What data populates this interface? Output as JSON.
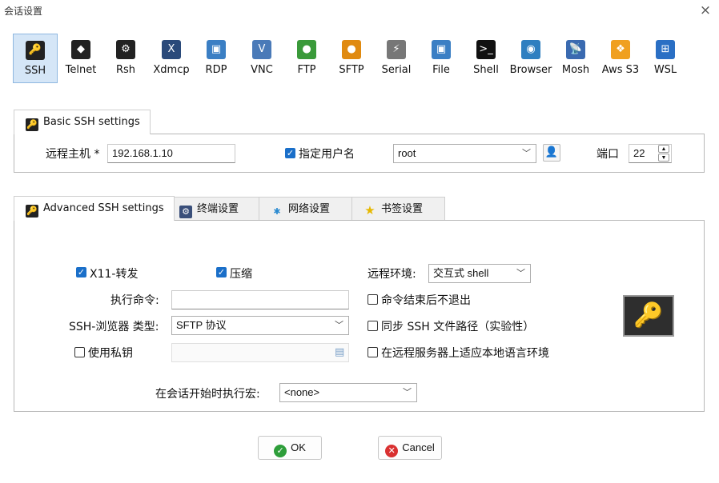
{
  "window": {
    "title": "会话设置",
    "close_glyph": "×"
  },
  "protocols": [
    {
      "label": "SSH",
      "icon": "ssh-key-icon",
      "color": "#222222",
      "glyph": "🔑",
      "active": true
    },
    {
      "label": "Telnet",
      "icon": "telnet-icon",
      "color": "#222222",
      "glyph": "◆"
    },
    {
      "label": "Rsh",
      "icon": "rsh-icon",
      "color": "#222222",
      "glyph": "⚙"
    },
    {
      "label": "Xdmcp",
      "icon": "xdmcp-icon",
      "color": "#2a4a7a",
      "glyph": "X"
    },
    {
      "label": "RDP",
      "icon": "rdp-icon",
      "color": "#3b7fc4",
      "glyph": "▣"
    },
    {
      "label": "VNC",
      "icon": "vnc-icon",
      "color": "#4a7ab8",
      "glyph": "V"
    },
    {
      "label": "FTP",
      "icon": "ftp-globe-icon",
      "color": "#3a9a3a",
      "glyph": "●"
    },
    {
      "label": "SFTP",
      "icon": "sftp-globe-icon",
      "color": "#e08a10",
      "glyph": "●"
    },
    {
      "label": "Serial",
      "icon": "serial-plug-icon",
      "color": "#777777",
      "glyph": "⚡"
    },
    {
      "label": "File",
      "icon": "file-monitor-icon",
      "color": "#3b7fc4",
      "glyph": "▣"
    },
    {
      "label": "Shell",
      "icon": "shell-terminal-icon",
      "color": "#111111",
      "glyph": ">_"
    },
    {
      "label": "Browser",
      "icon": "browser-globe-icon",
      "color": "#2f7fc0",
      "glyph": "◉"
    },
    {
      "label": "Mosh",
      "icon": "mosh-satellite-icon",
      "color": "#3a6ab0",
      "glyph": "📡"
    },
    {
      "label": "Aws S3",
      "icon": "aws-s3-icon",
      "color": "#f0a020",
      "glyph": "❖"
    },
    {
      "label": "WSL",
      "icon": "windows-icon",
      "color": "#2a6fc4",
      "glyph": "⊞"
    }
  ],
  "basic": {
    "tab_label": "Basic SSH settings",
    "host_label": "远程主机 *",
    "host_value": "192.168.1.10",
    "specify_user_label": "指定用户名",
    "specify_user_checked": true,
    "username_value": "root",
    "port_label": "端口",
    "port_value": "22"
  },
  "advanced_tabs": [
    {
      "label": "Advanced SSH settings",
      "icon": "key-icon",
      "active": true
    },
    {
      "label": "终端设置",
      "icon": "terminal-settings-icon"
    },
    {
      "label": "网络设置",
      "icon": "network-icon"
    },
    {
      "label": "书签设置",
      "icon": "bookmark-star-icon"
    }
  ],
  "advanced": {
    "x11_label": "X11-转发",
    "x11_checked": true,
    "compress_label": "压缩",
    "compress_checked": true,
    "remote_env_label": "远程环境:",
    "remote_env_value": "交互式 shell",
    "exec_cmd_label": "执行命令:",
    "exec_cmd_value": "",
    "no_exit_label": "命令结束后不退出",
    "browser_type_label": "SSH-浏览器 类型:",
    "browser_type_value": "SFTP 协议",
    "sync_path_label": "同步 SSH 文件路径（实验性）",
    "private_key_label": "使用私钥",
    "private_key_value": "",
    "locale_label": "在远程服务器上适应本地语言环境",
    "macro_label": "在会话开始时执行宏:",
    "macro_value": "<none>"
  },
  "buttons": {
    "ok": "OK",
    "cancel": "Cancel"
  }
}
